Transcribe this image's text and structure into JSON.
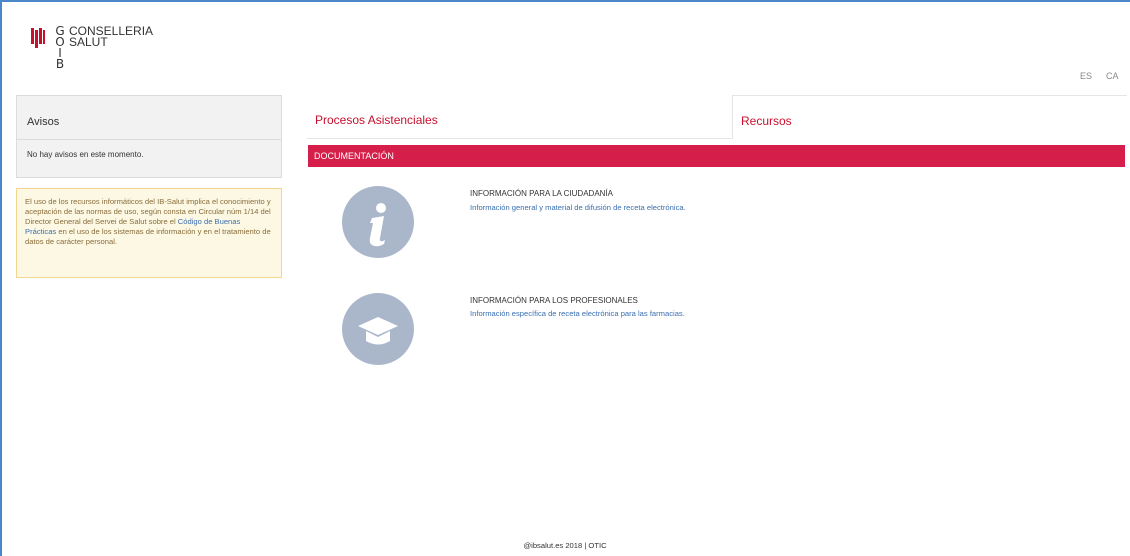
{
  "header": {
    "logo_letters": [
      "G",
      "O",
      "I",
      "B"
    ],
    "logo_line1": "CONSELLERIA",
    "logo_line2": "SALUT",
    "lang_es": "ES",
    "lang_ca": "CA"
  },
  "sidebar": {
    "avisos_title": "Avisos",
    "avisos_message": "No hay avisos en este momento.",
    "notice_part1": "El uso de los recursos informáticos del IB-Salut implica el conocimiento y aceptación de las normas de uso, según consta en Circular núm 1/14 del Director General del Servei de Salut sobre el ",
    "notice_link": "Código de Buenas Prácticas",
    "notice_part2": " en el uso de los sistemas de información y en el tratamiento de datos de carácter personal."
  },
  "tabs": [
    {
      "label": "Procesos Asistenciales"
    },
    {
      "label": "Recursos"
    }
  ],
  "section": {
    "title": "DOCUMENTACIÓN"
  },
  "resources": [
    {
      "icon": "info-icon",
      "title": "INFORMACIÓN PARA LA CIUDADANÍA",
      "link": "Información general y material de difusión de receta electrónica."
    },
    {
      "icon": "graduation-cap-icon",
      "title": "INFORMACIÓN PARA LOS PROFESIONALES",
      "link": "Información específica de receta electrónica para las farmacias."
    }
  ],
  "footer": {
    "text": "@ibsalut.es 2018 | OTIC"
  },
  "colors": {
    "accent": "#d51f4a",
    "brand_red": "#c8102e",
    "link": "#3a6fb0",
    "icon_circle": "#aab7cb",
    "notice_bg": "#fcf8e3"
  }
}
